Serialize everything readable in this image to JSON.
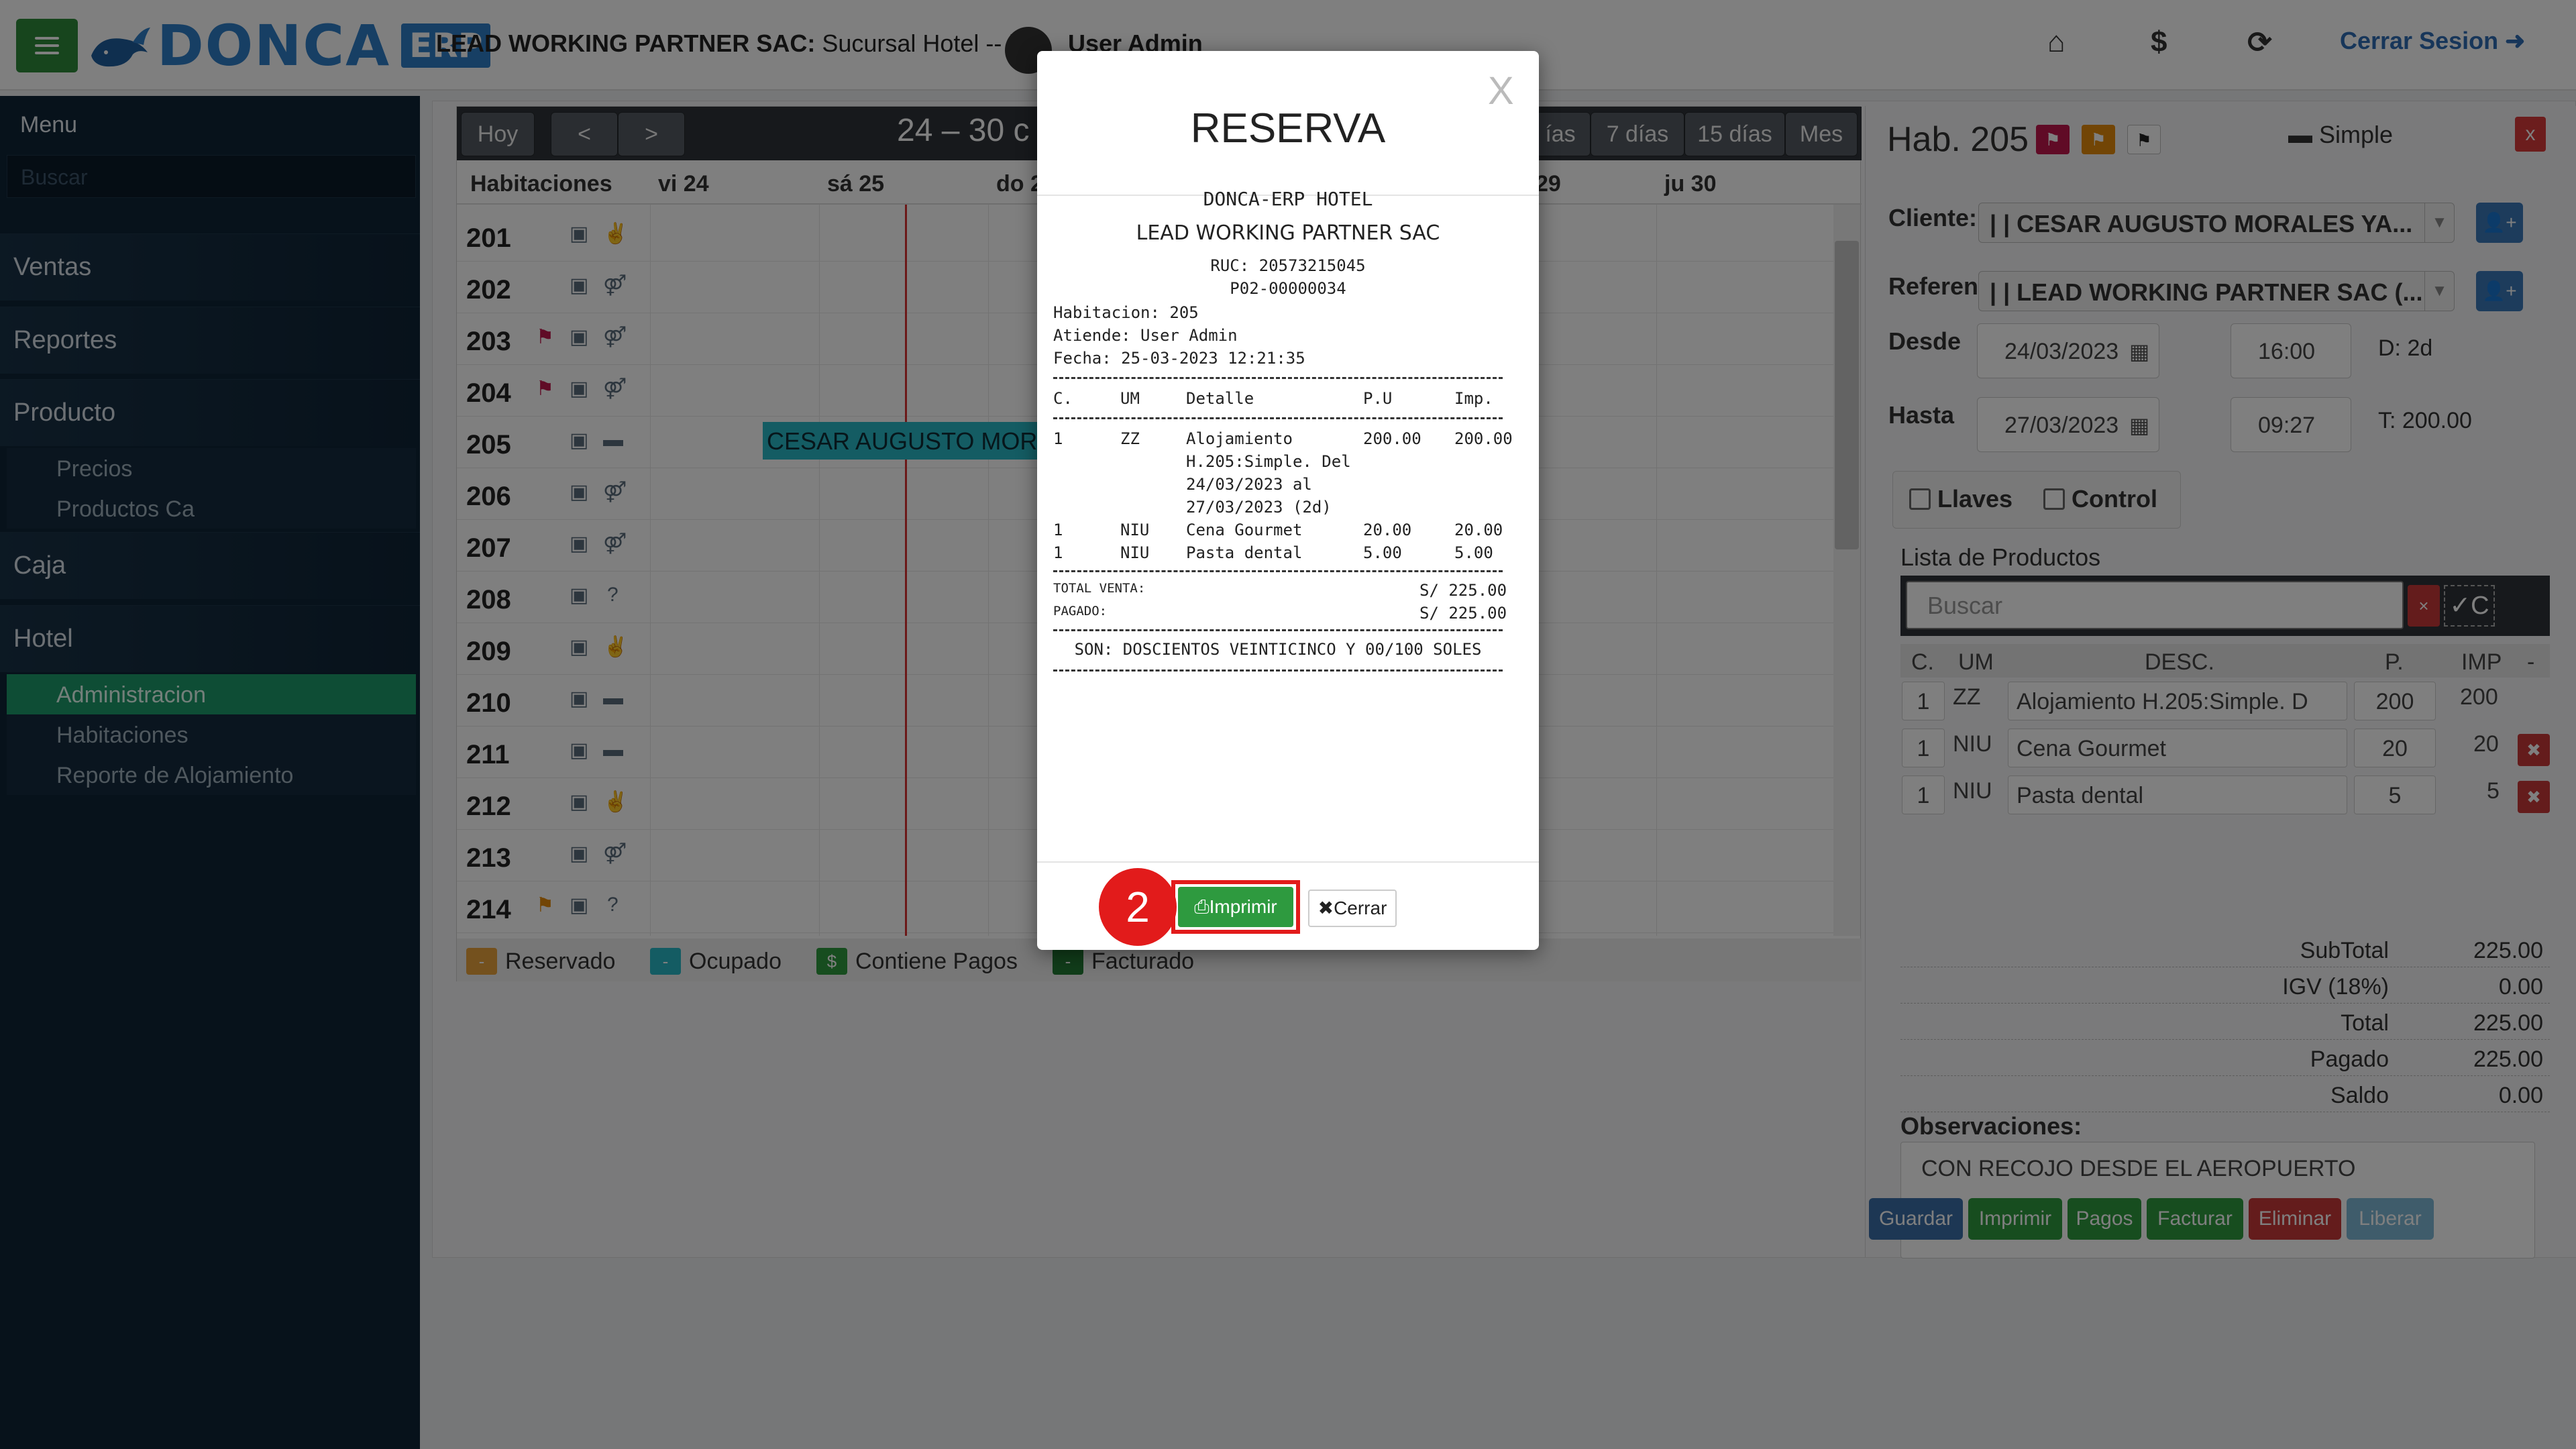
{
  "topbar": {
    "logo_text": "DONCA",
    "logo_badge": "ERP",
    "company_bold": "LEAD WORKING PARTNER SAC:",
    "company_rest": " Sucursal Hotel -- |",
    "user_name": "User Admin",
    "logout_label": "Cerrar Sesion"
  },
  "sidebar": {
    "title": "Menu",
    "search_placeholder": "Buscar",
    "items": [
      {
        "label": "Ventas"
      },
      {
        "label": "Reportes"
      },
      {
        "label": "Producto"
      },
      {
        "label": "Caja"
      },
      {
        "label": "Hotel"
      }
    ],
    "producto_sub": [
      "Precios",
      "Productos Ca"
    ],
    "hotel_sub": [
      "Administracion",
      "Habitaciones",
      "Reporte de Alojamiento"
    ]
  },
  "calendar": {
    "today_label": "Hoy",
    "prev_label": "<",
    "next_label": ">",
    "title": "24 – 30 c",
    "view_buttons": [
      "ías",
      "7 días",
      "15 días",
      "Mes"
    ],
    "rooms_header": "Habitaciones",
    "day_headers": [
      "vi 24",
      "sá 25",
      "do 2",
      "29",
      "ju 30"
    ],
    "rooms": [
      {
        "num": "201"
      },
      {
        "num": "202"
      },
      {
        "num": "203"
      },
      {
        "num": "204"
      },
      {
        "num": "205"
      },
      {
        "num": "206"
      },
      {
        "num": "207"
      },
      {
        "num": "208"
      },
      {
        "num": "209"
      },
      {
        "num": "210"
      },
      {
        "num": "211"
      },
      {
        "num": "212"
      },
      {
        "num": "213"
      },
      {
        "num": "214"
      }
    ],
    "event_label": "CESAR AUGUSTO MORA",
    "legend": [
      "Reservado",
      "Ocupado",
      "Contiene Pagos",
      "Facturado"
    ],
    "colors": {
      "reservado": "#e8a33d",
      "ocupado": "#29b9c6",
      "pagos": "#2e9a3f",
      "facturado": "#237a35"
    }
  },
  "panel": {
    "title": "Hab. 205",
    "type": "Simple",
    "close": "x",
    "cliente_label": "Cliente:",
    "cliente_value": "| | CESAR AUGUSTO MORALES YA...",
    "referen_label": "Referen",
    "referen_value": "| | LEAD WORKING PARTNER SAC (...",
    "desde_label": "Desde",
    "desde_date": "24/03/2023",
    "desde_time": "16:00",
    "days": "D: 2d",
    "hasta_label": "Hasta",
    "hasta_date": "27/03/2023",
    "hasta_time": "09:27",
    "total_short": "T: 200.00",
    "llaves": "Llaves",
    "control": "Control",
    "products_title": "Lista de Productos",
    "products_search": "Buscar",
    "products_x": "×",
    "products_c": "✓C",
    "columns": [
      "C.",
      "UM",
      "DESC.",
      "P.",
      "IMP",
      "-"
    ],
    "products": [
      {
        "c": "1",
        "um": "ZZ",
        "desc": "Alojamiento H.205:Simple. D",
        "p": "200",
        "imp": "200"
      },
      {
        "c": "1",
        "um": "NIU",
        "desc": "Cena Gourmet",
        "p": "20",
        "imp": "20"
      },
      {
        "c": "1",
        "um": "NIU",
        "desc": "Pasta dental",
        "p": "5",
        "imp": "5"
      }
    ],
    "totals": [
      {
        "label": "SubTotal",
        "value": "225.00"
      },
      {
        "label": "IGV (18%)",
        "value": "0.00"
      },
      {
        "label": "Total",
        "value": "225.00"
      },
      {
        "label": "Pagado",
        "value": "225.00"
      },
      {
        "label": "Saldo",
        "value": "0.00"
      }
    ],
    "obs_label": "Observaciones:",
    "obs_value": "CON RECOJO DESDE EL AEROPUERTO",
    "actions": [
      "Guardar",
      "Imprimir",
      "Pagos",
      "Facturar",
      "Eliminar",
      "Liberar"
    ]
  },
  "modal": {
    "close_x": "X",
    "title": "RESERVA",
    "ticket": {
      "header": "DONCA-ERP HOTEL",
      "company": "LEAD WORKING PARTNER SAC",
      "ruc": "RUC: 20573215045",
      "doc": "P02-00000034",
      "habitacion": "Habitacion: 205",
      "atiende": "Atiende: User Admin",
      "fecha": "Fecha: 25-03-2023 12:21:35",
      "cols": [
        "C.",
        "UM",
        "Detalle",
        "P.U",
        "Imp."
      ],
      "lines": [
        {
          "c": "1",
          "um": "ZZ",
          "detail": [
            "Alojamiento",
            "H.205:Simple. Del",
            "24/03/2023 al",
            "27/03/2023 (2d)"
          ],
          "pu": "200.00",
          "imp": "200.00"
        },
        {
          "c": "1",
          "um": "NIU",
          "detail": [
            "Cena Gourmet"
          ],
          "pu": "20.00",
          "imp": "20.00"
        },
        {
          "c": "1",
          "um": "NIU",
          "detail": [
            "Pasta dental"
          ],
          "pu": "5.00",
          "imp": "5.00"
        }
      ],
      "total_venta_label": "TOTAL VENTA:",
      "total_venta": "S/ 225.00",
      "pagado_label": "PAGADO:",
      "pagado": "S/ 225.00",
      "son": "SON: DOSCIENTOS VEINTICINCO Y 00/100 SOLES"
    },
    "step": "2",
    "print_label": "Imprimir",
    "close_label": "Cerrar"
  }
}
